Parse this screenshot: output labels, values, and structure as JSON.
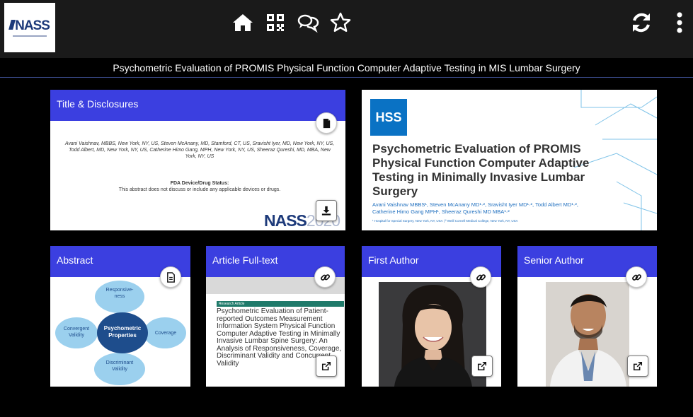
{
  "header": {
    "logo_text": "NASS",
    "nav": [
      {
        "icon": "home-icon"
      },
      {
        "icon": "qr-code-icon"
      },
      {
        "icon": "chat-icon"
      },
      {
        "icon": "star-icon"
      }
    ],
    "refresh_icon": "refresh-icon",
    "menu_icon": "more-vertical-icon"
  },
  "page_title": "Psychometric Evaluation of PROMIS Physical Function Computer Adaptive Testing in MIS Lumbar Surgery",
  "colors": {
    "accent": "#3b3fe0",
    "hss_blue": "#0a72c4",
    "bg": "#000000"
  },
  "cards": {
    "disclosures": {
      "label": "Title & Disclosures",
      "authors": "Avani Vaishnav, MBBS, New York, NY, US, Steven McAnany, MD, Stamford, CT, US, Sravisht Iyer, MD, New York, NY, US, Todd Albert, MD, New York, NY, US, Catherine Himo  Gang, MPH, New York, NY, US, Sheeraz Qureshi, MD, MBA, New York, NY, US",
      "status_title": "FDA Device/Drug Status:",
      "status_body": "This abstract does not discuss or include any applicable devices or drugs.",
      "footer_logo": "NASS",
      "footer_year": "2020"
    },
    "poster": {
      "badge": "HSS",
      "title": "Psychometric Evaluation of PROMIS Physical Function Computer Adaptive Testing in Minimally Invasive Lumbar Surgery",
      "authors": "Avani Vaishnav MBBS¹, Steven McAnany MD¹·², Sravisht Iyer MD¹·², Todd Albert MD¹·², Catherine Himo Gang MPH¹, Sheeraz Qureshi MD MBA¹·²",
      "affiliations": "¹ Hospital for Special Surgery, New York, NY, USA  | ² Weill Cornell Medical College, New York, NY, USA"
    },
    "abstract": {
      "label": "Abstract",
      "diagram": {
        "center": "Psychometric Properties",
        "top": "Responsive-ness",
        "left": "Convergent Validity",
        "right": "Coverage",
        "bottom": "Discriminant Validity"
      }
    },
    "article": {
      "label": "Article Full-text",
      "tag": "Research Article",
      "title": "Psychometric Evaluation of Patient-reported Outcomes Measurement Information System Physical Function Computer Adaptive Testing in Minimally Invasive Lumbar Spine Surgery: An Analysis of Responsiveness, Coverage, Discriminant Validity and Concurrent Validity"
    },
    "first_author": {
      "label": "First Author"
    },
    "senior_author": {
      "label": "Senior Author"
    }
  }
}
